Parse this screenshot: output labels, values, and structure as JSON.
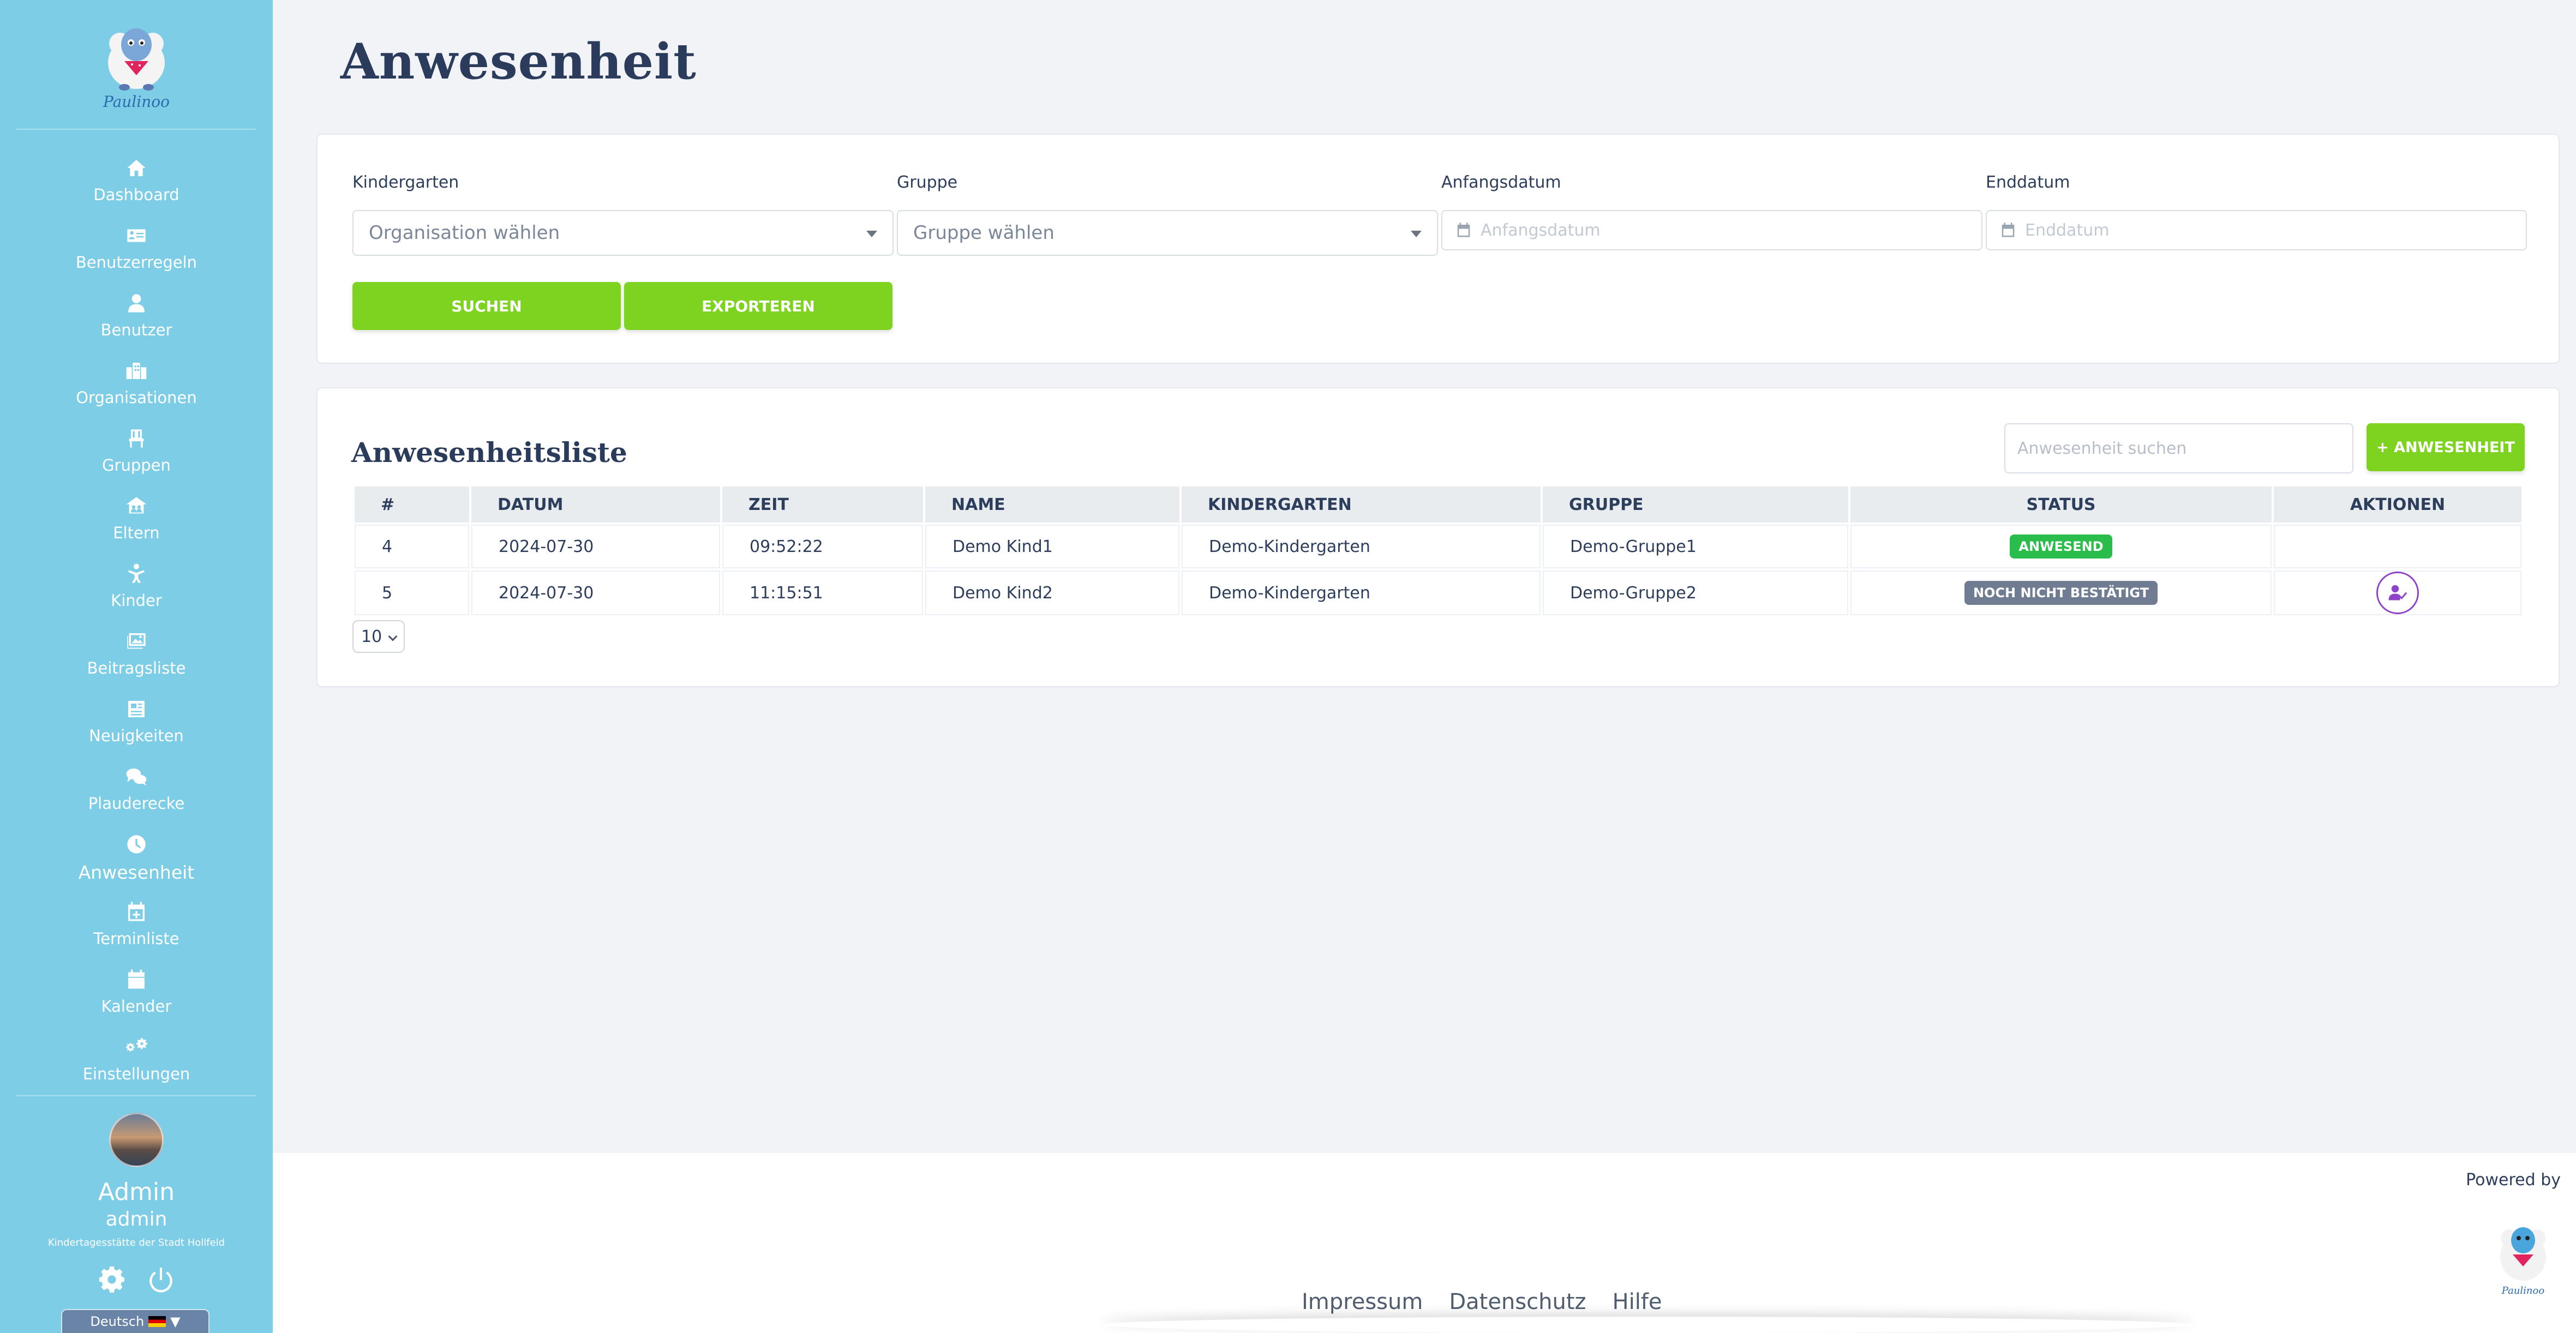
{
  "sidebar": {
    "brand": "Paulinoo",
    "items": [
      {
        "label": "Dashboard",
        "icon": "home-icon"
      },
      {
        "label": "Benutzerregeln",
        "icon": "id-card-icon"
      },
      {
        "label": "Benutzer",
        "icon": "user-icon"
      },
      {
        "label": "Organisationen",
        "icon": "building-icon"
      },
      {
        "label": "Gruppen",
        "icon": "chair-icon"
      },
      {
        "label": "Eltern",
        "icon": "parents-icon"
      },
      {
        "label": "Kinder",
        "icon": "child-icon"
      },
      {
        "label": "Beitragsliste",
        "icon": "image-icon"
      },
      {
        "label": "Neuigkeiten",
        "icon": "newspaper-icon"
      },
      {
        "label": "Plauderecke",
        "icon": "chat-icon"
      },
      {
        "label": "Anwesenheit",
        "icon": "clock-icon"
      },
      {
        "label": "Terminliste",
        "icon": "calendar-plus-icon"
      },
      {
        "label": "Kalender",
        "icon": "calendar-icon"
      },
      {
        "label": "Einstellungen",
        "icon": "gears-icon"
      }
    ],
    "active_index": 10,
    "user": {
      "name": "Admin",
      "login": "admin",
      "organization": "Kindertagesstätte der Stadt Hollfeld"
    },
    "language": "Deutsch"
  },
  "page": {
    "title": "Anwesenheit"
  },
  "filters": {
    "kindergarten_label": "Kindergarten",
    "kindergarten_placeholder": "Organisation wählen",
    "gruppe_label": "Gruppe",
    "gruppe_placeholder": "Gruppe wählen",
    "start_label": "Anfangsdatum",
    "start_placeholder": "Anfangsdatum",
    "end_label": "Enddatum",
    "end_placeholder": "Enddatum",
    "search_button": "SUCHEN",
    "export_button": "EXPORTEREN"
  },
  "list": {
    "title": "Anwesenheitsliste",
    "search_placeholder": "Anwesenheit suchen",
    "add_button": "+ ANWESENHEIT",
    "columns": [
      "#",
      "DATUM",
      "ZEIT",
      "NAME",
      "KINDERGARTEN",
      "GRUPPE",
      "STATUS",
      "AKTIONEN"
    ],
    "rows": [
      {
        "id": "4",
        "datum": "2024-07-30",
        "zeit": "09:52:22",
        "name": "Demo Kind1",
        "kindergarten": "Demo-Kindergarten",
        "gruppe": "Demo-Gruppe1",
        "status": "ANWESEND",
        "status_color": "#2bbd4c",
        "has_action": false
      },
      {
        "id": "5",
        "datum": "2024-07-30",
        "zeit": "11:15:51",
        "name": "Demo Kind2",
        "kindergarten": "Demo-Kindergarten",
        "gruppe": "Demo-Gruppe2",
        "status": "NOCH NICHT BESTÄTIGT",
        "status_color": "#6f7c92",
        "has_action": true
      }
    ],
    "page_size": "10"
  },
  "footer": {
    "powered_by": "Powered by",
    "links": [
      "Impressum",
      "Datenschutz",
      "Hilfe"
    ]
  },
  "colors": {
    "sidebar": "#7ecde6",
    "accent_green": "#7ed321",
    "action_purple": "#8e44c9"
  }
}
